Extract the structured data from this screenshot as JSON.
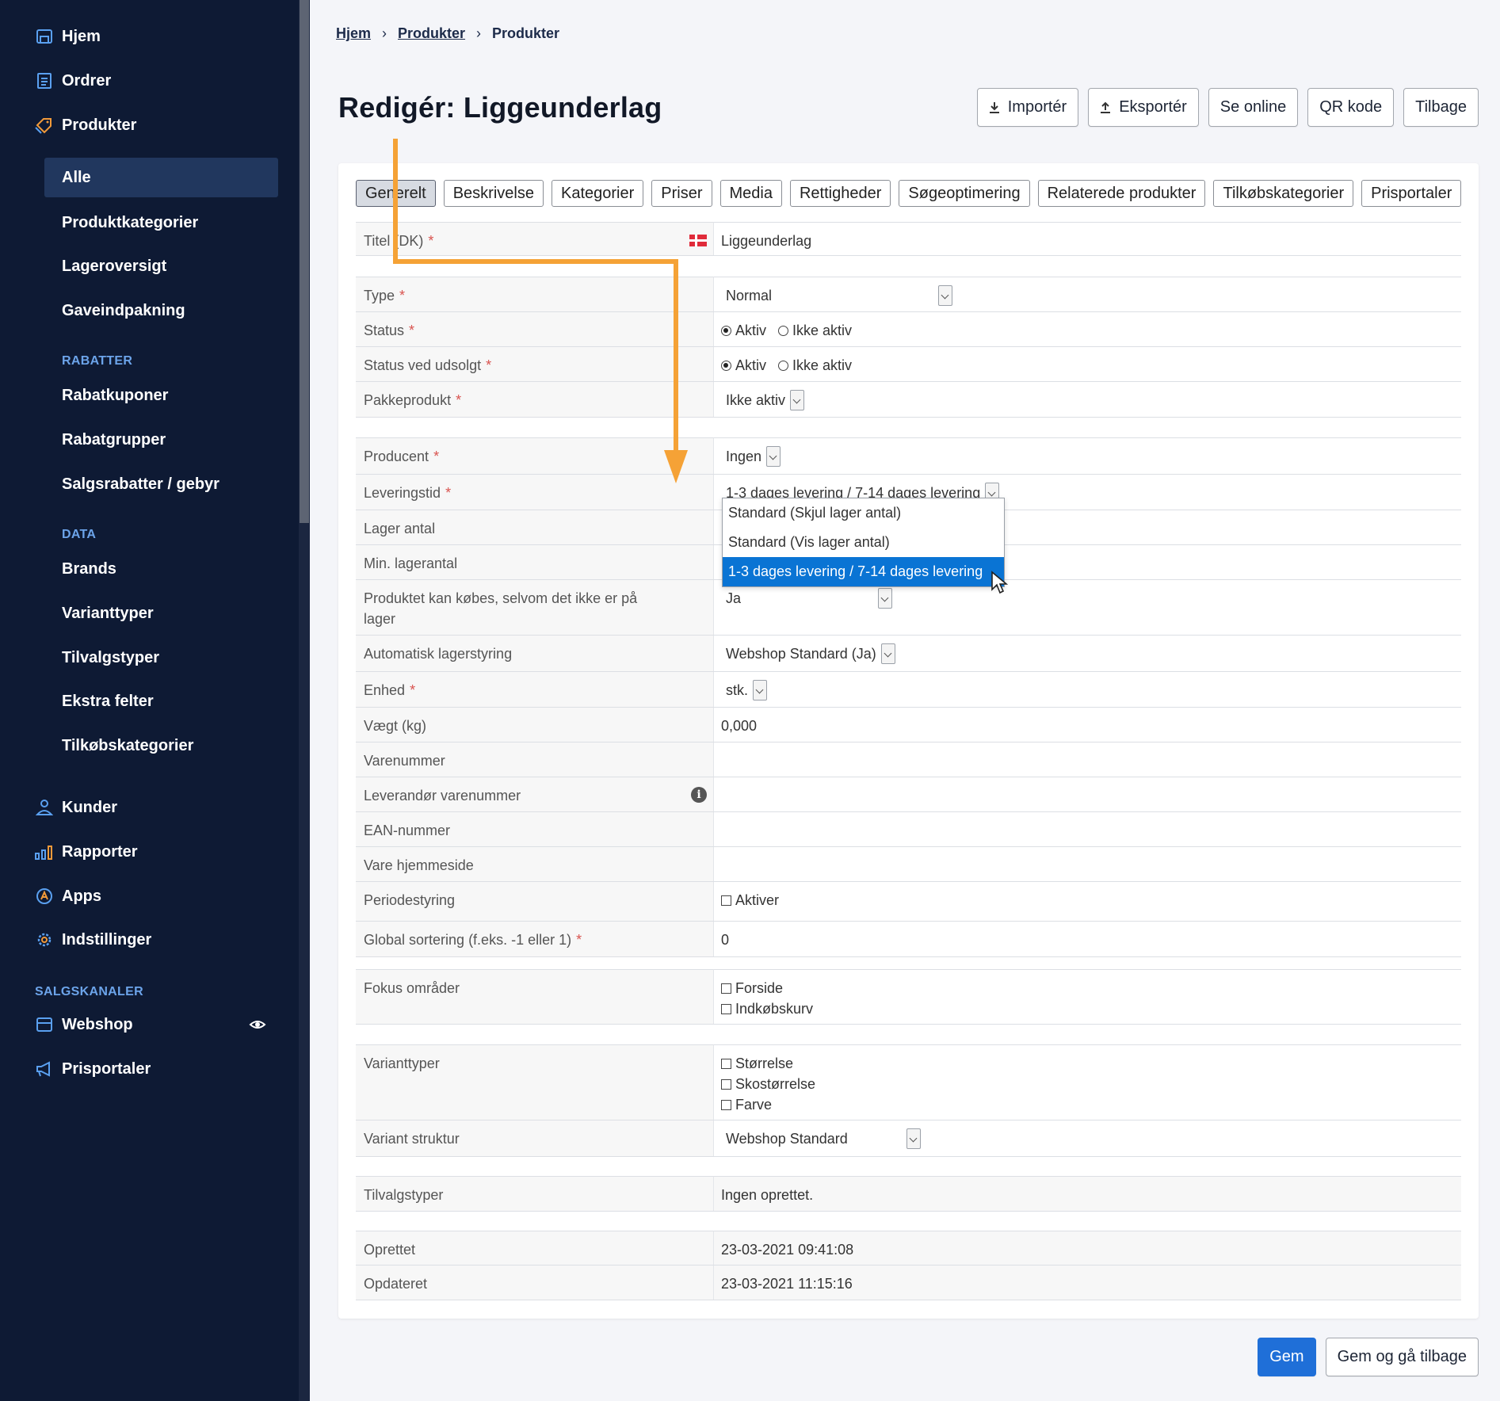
{
  "sidebar": {
    "main": [
      {
        "label": "Hjem",
        "icon": "home-icon"
      },
      {
        "label": "Ordrer",
        "icon": "orders-icon"
      },
      {
        "label": "Produkter",
        "icon": "tag-icon"
      }
    ],
    "products_sub": [
      {
        "label": "Alle",
        "active": true
      },
      {
        "label": "Produktkategorier"
      },
      {
        "label": "Lageroversigt"
      },
      {
        "label": "Gaveindpakning"
      }
    ],
    "rabatter_title": "RABATTER",
    "rabatter": [
      "Rabatkuponer",
      "Rabatgrupper",
      "Salgsrabatter / gebyr"
    ],
    "data_title": "DATA",
    "data": [
      "Brands",
      "Varianttyper",
      "Tilvalgstyper",
      "Ekstra felter",
      "Tilkøbskategorier"
    ],
    "lower": [
      {
        "label": "Kunder",
        "icon": "user-icon"
      },
      {
        "label": "Rapporter",
        "icon": "chart-icon"
      },
      {
        "label": "Apps",
        "icon": "apps-icon"
      },
      {
        "label": "Indstillinger",
        "icon": "gear-icon"
      }
    ],
    "channels_title": "SALGSKANALER",
    "channels": [
      {
        "label": "Webshop",
        "icon": "shop-icon"
      },
      {
        "label": "Prisportaler",
        "icon": "megaphone-icon"
      }
    ]
  },
  "breadcrumb": [
    "Hjem",
    "Produkter",
    "Produkter"
  ],
  "page_title": "Redigér: Liggeunderlag",
  "top_actions": {
    "import": "Importér",
    "export": "Eksportér",
    "online": "Se online",
    "qr": "QR kode",
    "back": "Tilbage"
  },
  "tabs": [
    "Generelt",
    "Beskrivelse",
    "Kategorier",
    "Priser",
    "Media",
    "Rettigheder",
    "Søgeoptimering",
    "Relaterede produkter",
    "Tilkøbskategorier",
    "Prisportaler"
  ],
  "form": {
    "titel_label": "Titel (DK)",
    "titel_value": "Liggeunderlag",
    "type_label": "Type",
    "type_value": "Normal",
    "status_label": "Status",
    "status_opt1": "Aktiv",
    "status_opt2": "Ikke aktiv",
    "udsolgt_label": "Status ved udsolgt",
    "udsolgt_opt1": "Aktiv",
    "udsolgt_opt2": "Ikke aktiv",
    "pakke_label": "Pakkeprodukt",
    "pakke_value": "Ikke aktiv",
    "producent_label": "Producent",
    "producent_value": "Ingen",
    "levering_label": "Leveringstid",
    "levering_value": "1-3 dages levering / 7-14 dages levering",
    "lager_label": "Lager antal",
    "minlager_label": "Min. lagerantal",
    "kobes_label": "Produktet kan købes, selvom det ikke er på lager",
    "kobes_value": "Ja",
    "auto_label": "Automatisk lagerstyring",
    "auto_value": "Webshop Standard (Ja)",
    "enhed_label": "Enhed",
    "enhed_value": "stk.",
    "vaegt_label": "Vægt (kg)",
    "vaegt_value": "0,000",
    "varenr_label": "Varenummer",
    "levvarenr_label": "Leverandør varenummer",
    "ean_label": "EAN-nummer",
    "hjemmeside_label": "Vare hjemmeside",
    "periode_label": "Periodestyring",
    "periode_value": "Aktiver",
    "sort_label": "Global sortering (f.eks. -1 eller 1)",
    "sort_value": "0",
    "fokus_label": "Fokus områder",
    "fokus_opt1": "Forside",
    "fokus_opt2": "Indkøbskurv",
    "variant_label": "Varianttyper",
    "variant_opt1": "Størrelse",
    "variant_opt2": "Skostørrelse",
    "variant_opt3": "Farve",
    "struktur_label": "Variant struktur",
    "struktur_value": "Webshop Standard",
    "tilvalg_label": "Tilvalgstyper",
    "tilvalg_value": "Ingen oprettet.",
    "oprettet_label": "Oprettet",
    "oprettet_value": "23-03-2021 09:41:08",
    "opdateret_label": "Opdateret",
    "opdateret_value": "23-03-2021 11:15:16"
  },
  "dropdown_options": [
    "Standard (Skjul lager antal)",
    "Standard (Vis lager antal)",
    "1-3 dages levering / 7-14 dages levering"
  ],
  "bottom_actions": {
    "save": "Gem",
    "save_back": "Gem og gå tilbage"
  },
  "colors": {
    "sidebar": "#0e1a34",
    "active_nav": "#21375e",
    "accent_blue": "#1f6fd8",
    "annotation": "#f5a236"
  }
}
